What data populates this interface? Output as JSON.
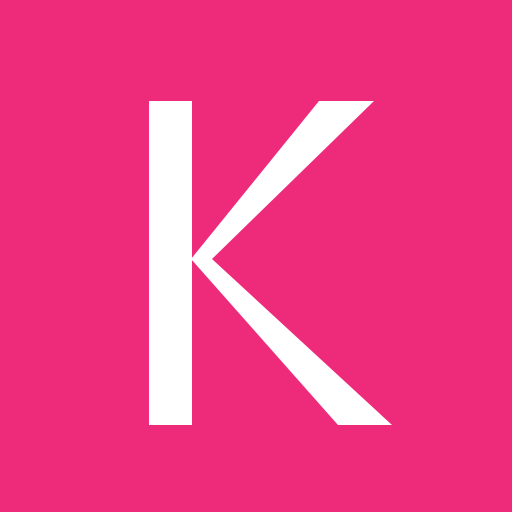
{
  "app_icon": {
    "letter": "K",
    "background_color": "#ee2a7b",
    "foreground_color": "#ffffff",
    "icon_name": "letter-k-logo-icon"
  }
}
